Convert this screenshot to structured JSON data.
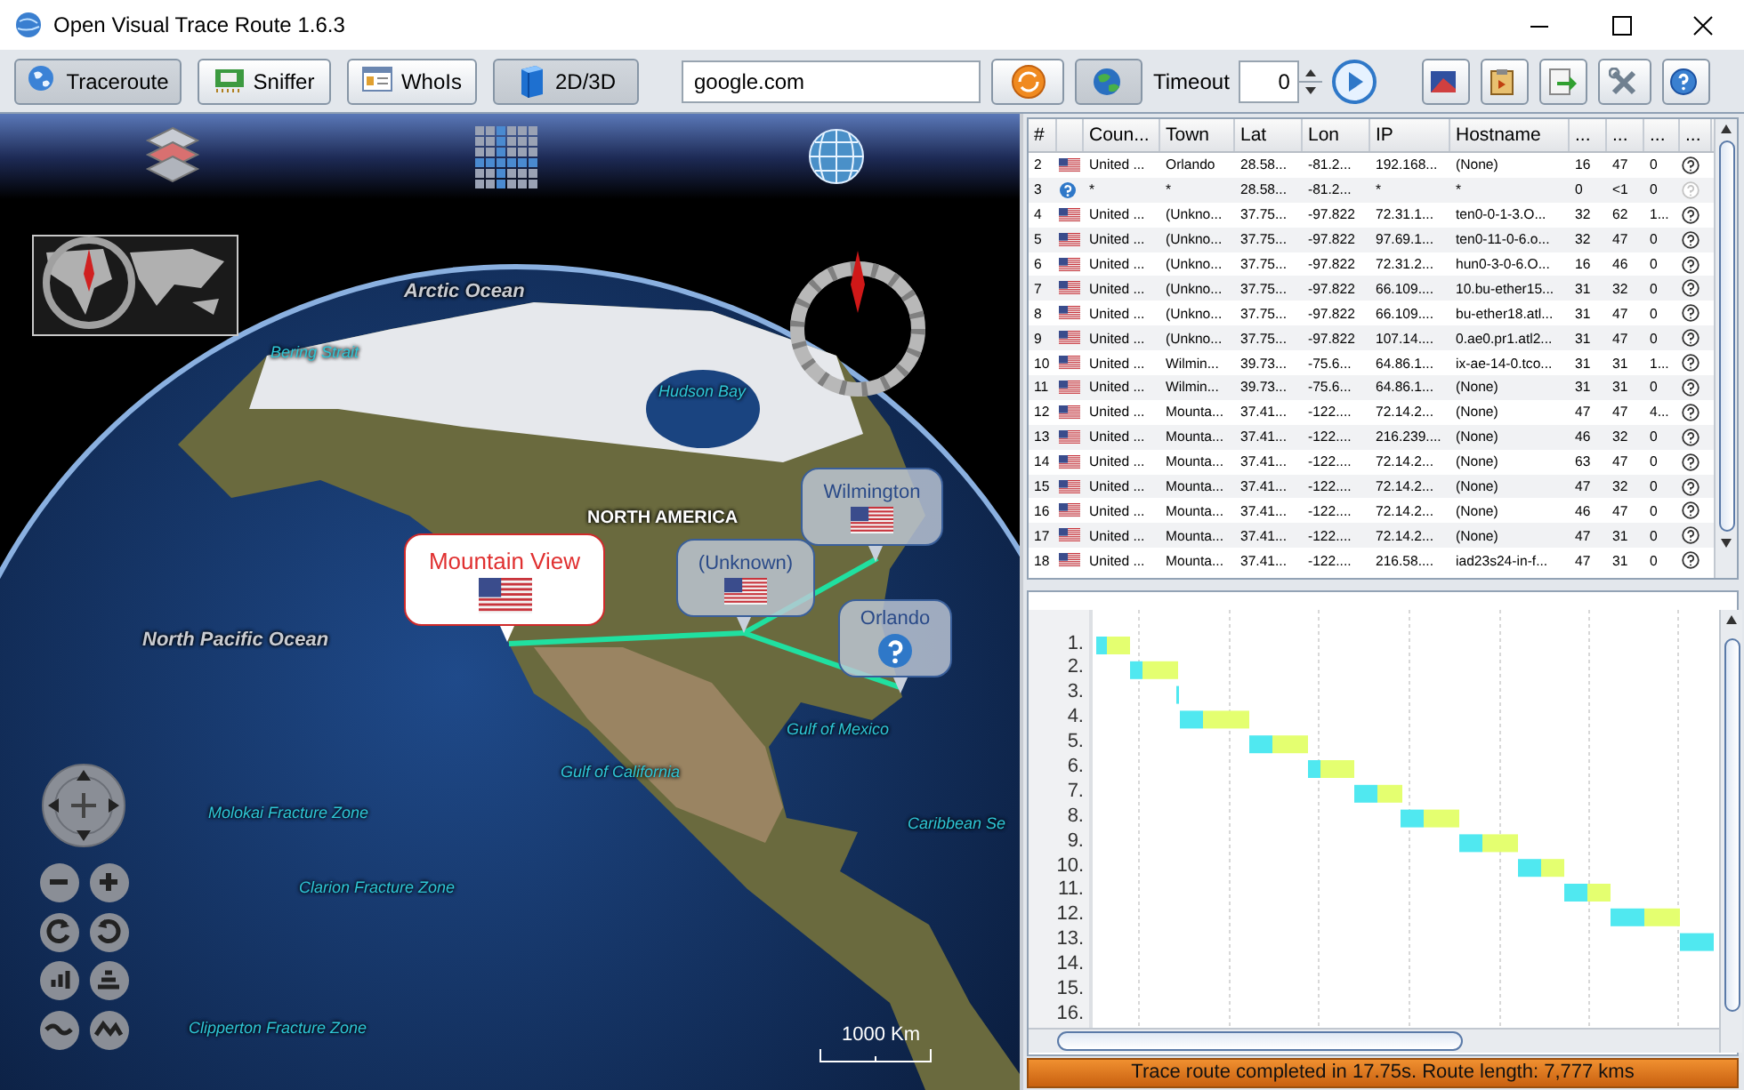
{
  "window": {
    "title": "Open Visual Trace Route 1.6.3"
  },
  "toolbar": {
    "buttons": [
      {
        "label": "Traceroute",
        "kind": "globe",
        "selected": true
      },
      {
        "label": "Sniffer",
        "kind": "card",
        "selected": false
      },
      {
        "label": "WhoIs",
        "kind": "form",
        "selected": false
      },
      {
        "label": "2D/3D",
        "kind": "cube",
        "selected": true
      }
    ],
    "target": {
      "value": "google.com"
    },
    "timeout": {
      "label": "Timeout",
      "value": "0"
    }
  },
  "map": {
    "labels": [
      {
        "text": "Arctic Ocean",
        "kind": "ocean"
      },
      {
        "text": "Bering Strait",
        "kind": "feature"
      },
      {
        "text": "Hudson Bay",
        "kind": "feature"
      },
      {
        "text": "NORTH AMERICA",
        "kind": "continent"
      },
      {
        "text": "North Pacific Ocean",
        "kind": "ocean"
      },
      {
        "text": "Gulf of Mexico",
        "kind": "feature"
      },
      {
        "text": "Gulf of California",
        "kind": "feature"
      },
      {
        "text": "Molokai Fracture Zone",
        "kind": "feature"
      },
      {
        "text": "Caribbean Se",
        "kind": "feature"
      },
      {
        "text": "Clarion Fracture Zone",
        "kind": "feature"
      },
      {
        "text": "Clipperton Fracture Zone",
        "kind": "feature"
      }
    ],
    "callouts": [
      {
        "town": "Wilmington",
        "kind": "flag",
        "highlighted": false
      },
      {
        "town": "Mountain View",
        "kind": "flag",
        "highlighted": true
      },
      {
        "town": "(Unknown)",
        "kind": "flag",
        "highlighted": false
      },
      {
        "town": "Orlando",
        "kind": "unknown",
        "highlighted": false
      }
    ],
    "scale": "1000 Km"
  },
  "table": {
    "columns": [
      "#",
      "Coun...",
      "Town",
      "Lat",
      "Lon",
      "IP",
      "Hostname",
      "...",
      "...",
      "...",
      "..."
    ],
    "rows": [
      {
        "num": "2",
        "kind": "flag",
        "country": "United ...",
        "town": "Orlando",
        "lat": "28.58...",
        "lon": "-81.2...",
        "ip": "192.168...",
        "hostname": "(None)",
        "col_9": "16",
        "col_10": "47",
        "col_11": "0",
        "help_enabled": true
      },
      {
        "num": "3",
        "kind": "unknown",
        "country": "*",
        "town": "*",
        "lat": "28.58...",
        "lon": "-81.2...",
        "ip": "*",
        "hostname": "*",
        "col_9": "0",
        "col_10": "<1",
        "col_11": "0",
        "help_enabled": false
      },
      {
        "num": "4",
        "kind": "flag",
        "country": "United ...",
        "town": "(Unkno...",
        "lat": "37.75...",
        "lon": "-97.822",
        "ip": "72.31.1...",
        "hostname": "ten0-0-1-3.O...",
        "col_9": "32",
        "col_10": "62",
        "col_11": "1...",
        "help_enabled": true
      },
      {
        "num": "5",
        "kind": "flag",
        "country": "United ...",
        "town": "(Unkno...",
        "lat": "37.75...",
        "lon": "-97.822",
        "ip": "97.69.1...",
        "hostname": "ten0-11-0-6.o...",
        "col_9": "32",
        "col_10": "47",
        "col_11": "0",
        "help_enabled": true
      },
      {
        "num": "6",
        "kind": "flag",
        "country": "United ...",
        "town": "(Unkno...",
        "lat": "37.75...",
        "lon": "-97.822",
        "ip": "72.31.2...",
        "hostname": "hun0-3-0-6.O...",
        "col_9": "16",
        "col_10": "46",
        "col_11": "0",
        "help_enabled": true
      },
      {
        "num": "7",
        "kind": "flag",
        "country": "United ...",
        "town": "(Unkno...",
        "lat": "37.75...",
        "lon": "-97.822",
        "ip": "66.109....",
        "hostname": "10.bu-ether15...",
        "col_9": "31",
        "col_10": "32",
        "col_11": "0",
        "help_enabled": true
      },
      {
        "num": "8",
        "kind": "flag",
        "country": "United ...",
        "town": "(Unkno...",
        "lat": "37.75...",
        "lon": "-97.822",
        "ip": "66.109....",
        "hostname": "bu-ether18.atl...",
        "col_9": "31",
        "col_10": "47",
        "col_11": "0",
        "help_enabled": true
      },
      {
        "num": "9",
        "kind": "flag",
        "country": "United ...",
        "town": "(Unkno...",
        "lat": "37.75...",
        "lon": "-97.822",
        "ip": "107.14....",
        "hostname": "0.ae0.pr1.atl2...",
        "col_9": "31",
        "col_10": "47",
        "col_11": "0",
        "help_enabled": true
      },
      {
        "num": "10",
        "kind": "flag",
        "country": "United ...",
        "town": "Wilmin...",
        "lat": "39.73...",
        "lon": "-75.6...",
        "ip": "64.86.1...",
        "hostname": "ix-ae-14-0.tco...",
        "col_9": "31",
        "col_10": "31",
        "col_11": "1...",
        "help_enabled": true
      },
      {
        "num": "11",
        "kind": "flag",
        "country": "United ...",
        "town": "Wilmin...",
        "lat": "39.73...",
        "lon": "-75.6...",
        "ip": "64.86.1...",
        "hostname": "(None)",
        "col_9": "31",
        "col_10": "31",
        "col_11": "0",
        "help_enabled": true
      },
      {
        "num": "12",
        "kind": "flag",
        "country": "United ...",
        "town": "Mounta...",
        "lat": "37.41...",
        "lon": "-122....",
        "ip": "72.14.2...",
        "hostname": "(None)",
        "col_9": "47",
        "col_10": "47",
        "col_11": "4...",
        "help_enabled": true
      },
      {
        "num": "13",
        "kind": "flag",
        "country": "United ...",
        "town": "Mounta...",
        "lat": "37.41...",
        "lon": "-122....",
        "ip": "216.239....",
        "hostname": "(None)",
        "col_9": "46",
        "col_10": "32",
        "col_11": "0",
        "help_enabled": true
      },
      {
        "num": "14",
        "kind": "flag",
        "country": "United ...",
        "town": "Mounta...",
        "lat": "37.41...",
        "lon": "-122....",
        "ip": "72.14.2...",
        "hostname": "(None)",
        "col_9": "63",
        "col_10": "47",
        "col_11": "0",
        "help_enabled": true
      },
      {
        "num": "15",
        "kind": "flag",
        "country": "United ...",
        "town": "Mounta...",
        "lat": "37.41...",
        "lon": "-122....",
        "ip": "72.14.2...",
        "hostname": "(None)",
        "col_9": "47",
        "col_10": "32",
        "col_11": "0",
        "help_enabled": true
      },
      {
        "num": "16",
        "kind": "flag",
        "country": "United ...",
        "town": "Mounta...",
        "lat": "37.41...",
        "lon": "-122....",
        "ip": "72.14.2...",
        "hostname": "(None)",
        "col_9": "46",
        "col_10": "47",
        "col_11": "0",
        "help_enabled": true
      },
      {
        "num": "17",
        "kind": "flag",
        "country": "United ...",
        "town": "Mounta...",
        "lat": "37.41...",
        "lon": "-122....",
        "ip": "72.14.2...",
        "hostname": "(None)",
        "col_9": "47",
        "col_10": "31",
        "col_11": "0",
        "help_enabled": true
      },
      {
        "num": "18",
        "kind": "flag",
        "country": "United ...",
        "town": "Mounta...",
        "lat": "37.41...",
        "lon": "-122....",
        "ip": "216.58....",
        "hostname": "iad23s24-in-f...",
        "col_9": "47",
        "col_10": "31",
        "col_11": "0",
        "help_enabled": true
      }
    ]
  },
  "timeline": {
    "rows": [
      "1.",
      "2.",
      "3.",
      "4.",
      "5.",
      "6.",
      "7.",
      "8.",
      "9.",
      "10.",
      "11.",
      "12.",
      "13.",
      "14.",
      "15.",
      "16."
    ]
  },
  "status_bar": "Trace route completed in 17.75s. Route length: 7,777 kms"
}
